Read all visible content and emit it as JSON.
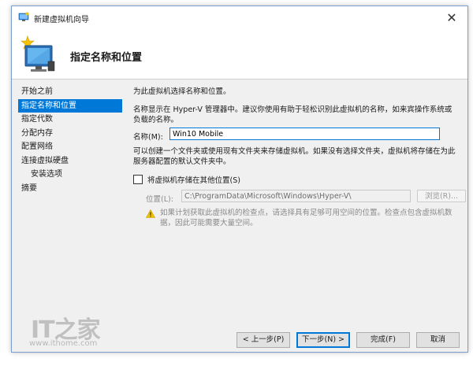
{
  "window": {
    "title": "新建虚拟机向导",
    "close_glyph": "✕"
  },
  "header": {
    "title": "指定名称和位置",
    "icon": "new-vm-wizard-icon"
  },
  "nav": {
    "items": [
      {
        "label": "开始之前",
        "selected": false,
        "sub": false
      },
      {
        "label": "指定名称和位置",
        "selected": true,
        "sub": false
      },
      {
        "label": "指定代数",
        "selected": false,
        "sub": false
      },
      {
        "label": "分配内存",
        "selected": false,
        "sub": false
      },
      {
        "label": "配置网络",
        "selected": false,
        "sub": false
      },
      {
        "label": "连接虚拟硬盘",
        "selected": false,
        "sub": false
      },
      {
        "label": "安装选项",
        "selected": false,
        "sub": true
      },
      {
        "label": "摘要",
        "selected": false,
        "sub": false
      }
    ]
  },
  "content": {
    "intro": "为此虚拟机选择名称和位置。",
    "name_hint": "名称显示在 Hyper-V 管理器中。建议你使用有助于轻松识别此虚拟机的名称，如来宾操作系统或负载的名称。",
    "name_label": "名称(M):",
    "name_value": "Win10 Mobile",
    "folder_hint": "可以创建一个文件夹或使用现有文件夹来存储虚拟机。如果没有选择文件夹，虚拟机将存储在为此服务器配置的默认文件夹中。",
    "store_checkbox_label": "将虚拟机存储在其他位置(S)",
    "store_checkbox_checked": false,
    "location_label": "位置(L):",
    "location_value": "C:\\ProgramData\\Microsoft\\Windows\\Hyper-V\\",
    "browse_label": "浏览(R)...",
    "warning": "如果计划获取此虚拟机的检查点，请选择具有足够可用空间的位置。检查点包含虚拟机数据，因此可能需要大量空间。"
  },
  "buttons": {
    "prev": "< 上一步(P)",
    "next": "下一步(N) >",
    "finish": "完成(F)",
    "cancel": "取消"
  },
  "watermark": {
    "logo": "IT之家",
    "url": "www.ithome.com"
  },
  "colors": {
    "accent": "#0078d7",
    "warning": "#f2c300"
  }
}
